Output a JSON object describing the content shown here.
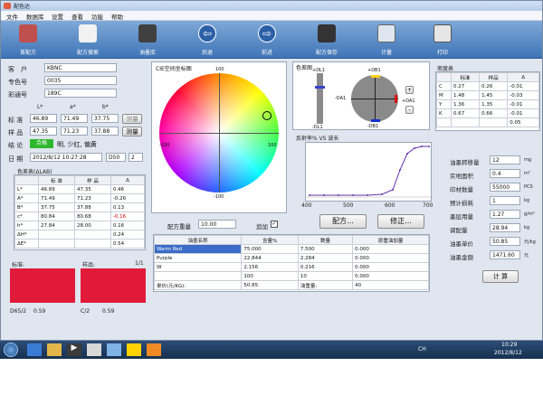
{
  "window": {
    "title": "配色达"
  },
  "menu": [
    "文件",
    "数据库",
    "设置",
    "查看",
    "功能",
    "帮助"
  ],
  "toolbar": [
    {
      "label": "首配方",
      "icon": "palette-icon",
      "color": "#c0504d"
    },
    {
      "label": "配方搜索",
      "icon": "document-search-icon",
      "color": "#f2f2f2"
    },
    {
      "label": "油墨库",
      "icon": "ink-cans-icon",
      "color": "#404040"
    },
    {
      "label": "后退",
      "icon": "back-arrow-icon",
      "color": "#2b5fa8"
    },
    {
      "label": "前进",
      "icon": "forward-arrow-icon",
      "color": "#2b5fa8"
    },
    {
      "label": "配方保存",
      "icon": "floppy-disk-icon",
      "color": "#333333"
    },
    {
      "label": "计量",
      "icon": "calculator-icon",
      "color": "#dfe6ef"
    },
    {
      "label": "打印",
      "icon": "printer-icon",
      "color": "#e6e6e6"
    }
  ],
  "customer": {
    "label": "客　户",
    "value": "KBNC"
  },
  "color_code": {
    "label": "专色号",
    "value": "0035"
  },
  "color_name": {
    "label": "彩通号",
    "value": "189C"
  },
  "lab_headers": [
    "L*",
    "a*",
    "b*"
  ],
  "standard": {
    "label": "标 准",
    "L": "46.89",
    "a": "71.49",
    "b": "37.75",
    "button": "测量"
  },
  "sample": {
    "label": "样 品",
    "L": "47.35",
    "a": "71.23",
    "b": "37.88",
    "button": "测量"
  },
  "conclusion": {
    "label": "结 论",
    "badge": "合格",
    "text": "明, 少红, 偏黄"
  },
  "date": {
    "label": "日 期",
    "value": "2012/8/12 10:27:28",
    "illuminant": "D50",
    "observer": "2"
  },
  "delta_table": {
    "title": "色差表(ΔLAB)",
    "headers": [
      "",
      "标 准",
      "样 品",
      "Δ"
    ],
    "rows": [
      [
        "L*",
        "46.89",
        "47.35",
        "0.46"
      ],
      [
        "A*",
        "71.49",
        "71.23",
        "-0.26"
      ],
      [
        "B*",
        "37.75",
        "37.88",
        "0.13"
      ],
      [
        "c*",
        "80.84",
        "80.68",
        "-0.16"
      ],
      [
        "h*",
        "27.84",
        "28.00",
        "0.16"
      ],
      [
        "ΔH*",
        "",
        "",
        "0.24"
      ],
      [
        "ΔE*",
        "",
        "",
        "0.54"
      ]
    ]
  },
  "swatch_labels": {
    "standard": "标准:",
    "sample": "样品:",
    "page": "1/1"
  },
  "swatch_footer": {
    "left_label": "D65/2",
    "left_value": "0.59",
    "right_label": "C/2",
    "right_value": "0.59"
  },
  "cie_title": "CIE空间坐标图",
  "cie_ticks": {
    "top": "100",
    "bottom": "-100",
    "left": "-100",
    "right": "100"
  },
  "color_diff_title": "色差图",
  "color_diff_labels": {
    "dl_top": "+DL1",
    "dl_bottom": "-DL1",
    "db_top": "+DB1",
    "db_bottom": "-DB1",
    "da_left": "-DA1",
    "da_right": "+DA1"
  },
  "density_table": {
    "title": "密度表",
    "headers": [
      "",
      "标准",
      "样品",
      "Δ"
    ],
    "rows": [
      [
        "C",
        "0.27",
        "0.26",
        "-0.01"
      ],
      [
        "M",
        "1.48",
        "1.45",
        "-0.03"
      ],
      [
        "Y",
        "1.36",
        "1.35",
        "-0.01"
      ],
      [
        "K",
        "0.67",
        "0.66",
        "-0.01"
      ],
      [
        "",
        "",
        "",
        "0.05"
      ]
    ]
  },
  "reflectance": {
    "title": "反射率% VS 波长",
    "x_ticks": [
      "400",
      "500",
      "600",
      "700"
    ]
  },
  "recipe": {
    "weight_label": "配方重量",
    "weight_value": "10.00",
    "append_label": "追加",
    "formula_button": "配方...",
    "modify_button": "修正...",
    "headers": [
      "油墨名称",
      "含量%",
      "数量",
      "原重油加量"
    ],
    "rows": [
      [
        "Warm Red",
        "75.000",
        "7.500",
        "0.000"
      ],
      [
        "Purple",
        "22.844",
        "2.284",
        "0.000"
      ],
      [
        "W",
        "2.156",
        "0.216",
        "0.000"
      ],
      [
        "",
        "100",
        "10",
        "0.000"
      ],
      [
        "单价(元/KG):",
        "50.85",
        "油重量:",
        "40"
      ]
    ]
  },
  "calc": {
    "fields": [
      {
        "label": "油墨转移量",
        "value": "12",
        "unit": "mg"
      },
      {
        "label": "实地面积",
        "value": "0.4",
        "unit": "m²"
      },
      {
        "label": "印材数量",
        "value": "55000",
        "unit": "PCS"
      },
      {
        "label": "预计损耗",
        "value": "1",
        "unit": "kg"
      },
      {
        "label": "墨层用量",
        "value": "1.27",
        "unit": "g/m²"
      },
      {
        "label": "调配量",
        "value": "28.94",
        "unit": "kg"
      },
      {
        "label": "油墨单价",
        "value": "50.85",
        "unit": "元/kg"
      },
      {
        "label": "油墨金额",
        "value": "1471.60",
        "unit": "元"
      }
    ],
    "button": "计 算"
  },
  "taskbar": {
    "time": "10:29",
    "date": "2012/8/12",
    "lang": "CH"
  }
}
